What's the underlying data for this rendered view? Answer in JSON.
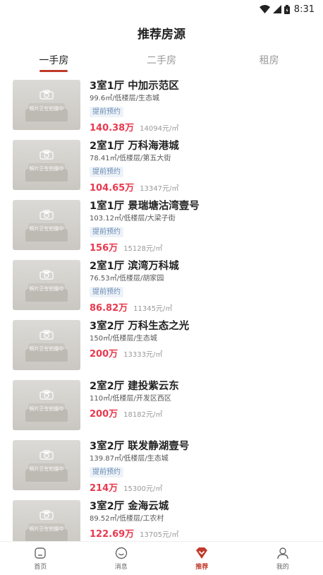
{
  "status": {
    "time": "8:31"
  },
  "header": {
    "title": "推荐房源"
  },
  "tabs": [
    {
      "label": "一手房",
      "active": true
    },
    {
      "label": "二手房",
      "active": false
    },
    {
      "label": "租房",
      "active": false
    }
  ],
  "thumb_caption": "照片正在拍摄中",
  "listings": [
    {
      "name": "3室1厅 中加示范区",
      "desc": "99.6㎡/低楼层/生态城",
      "badge": "提前预约",
      "price": "140.38万",
      "unit_price": "14094元/㎡"
    },
    {
      "name": "2室1厅 万科海港城",
      "desc": "78.41㎡/低楼层/第五大街",
      "badge": "提前预约",
      "price": "104.65万",
      "unit_price": "13347元/㎡"
    },
    {
      "name": "1室1厅 景瑞塘沽湾壹号",
      "desc": "103.12㎡/低楼层/大梁子街",
      "badge": "提前预约",
      "price": "156万",
      "unit_price": "15128元/㎡"
    },
    {
      "name": "2室1厅 滨湾万科城",
      "desc": "76.53㎡/低楼层/胡家园",
      "badge": "提前预约",
      "price": "86.82万",
      "unit_price": "11345元/㎡"
    },
    {
      "name": "3室2厅 万科生态之光",
      "desc": "150㎡/低楼层/生态城",
      "badge": "",
      "price": "200万",
      "unit_price": "13333元/㎡"
    },
    {
      "name": "2室2厅 建投紫云东",
      "desc": "110㎡/低楼层/开发区西区",
      "badge": "",
      "price": "200万",
      "unit_price": "18182元/㎡"
    },
    {
      "name": "3室2厅 联发静湖壹号",
      "desc": "139.87㎡/低楼层/生态城",
      "badge": "提前预约",
      "price": "214万",
      "unit_price": "15300元/㎡"
    },
    {
      "name": "3室2厅 金海云城",
      "desc": "89.52㎡/低楼层/工农村",
      "badge": "",
      "price": "122.69万",
      "unit_price": "13705元/㎡"
    }
  ],
  "tabbar": [
    {
      "label": "首页",
      "icon": "home-icon",
      "active": false
    },
    {
      "label": "消息",
      "icon": "message-icon",
      "active": false
    },
    {
      "label": "推荐",
      "icon": "recommend-icon",
      "active": true
    },
    {
      "label": "我的",
      "icon": "profile-icon",
      "active": false
    }
  ],
  "colors": {
    "accent": "#c0392b",
    "price": "#e8394e",
    "badge_text": "#6a8bb5",
    "badge_bg": "#eef3f8"
  }
}
